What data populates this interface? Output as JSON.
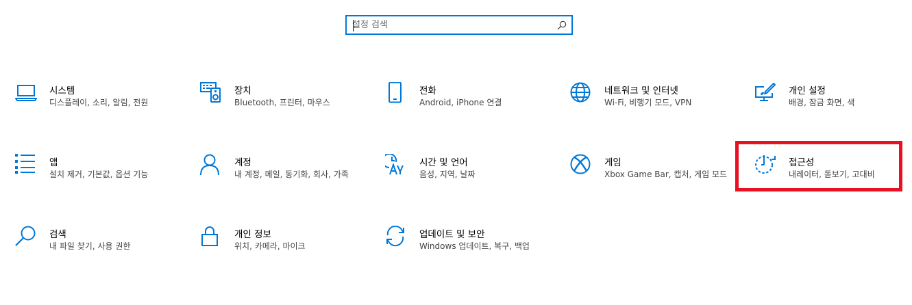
{
  "search": {
    "placeholder": "설정 검색",
    "value": ""
  },
  "accent_color": "#0078d7",
  "highlight_color": "#e81123",
  "tiles": [
    {
      "icon": "laptop-icon",
      "title": "시스템",
      "desc": "디스플레이, 소리, 알림, 전원"
    },
    {
      "icon": "keyboard-devices-icon",
      "title": "장치",
      "desc": "Bluetooth, 프린터, 마우스"
    },
    {
      "icon": "phone-icon",
      "title": "전화",
      "desc": "Android, iPhone 연결"
    },
    {
      "icon": "globe-icon",
      "title": "네트워크 및 인터넷",
      "desc": "Wi-Fi, 비행기 모드, VPN"
    },
    {
      "icon": "paint-monitor-icon",
      "title": "개인 설정",
      "desc": "배경, 잠금 화면, 색"
    },
    {
      "icon": "apps-list-icon",
      "title": "앱",
      "desc": "설치 제거, 기본값, 옵션 기능"
    },
    {
      "icon": "person-icon",
      "title": "계정",
      "desc": "내 계정, 메일, 동기화, 회사, 가족"
    },
    {
      "icon": "time-language-icon",
      "title": "시간 및 언어",
      "desc": "음성, 지역, 날짜"
    },
    {
      "icon": "xbox-icon",
      "title": "게임",
      "desc": "Xbox Game Bar, 캡처, 게임 모드"
    },
    {
      "icon": "accessibility-timer-icon",
      "title": "접근성",
      "desc": "내레이터, 돋보기, 고대비"
    },
    {
      "icon": "search-icon",
      "title": "검색",
      "desc": "내 파일 찾기, 사용 권한"
    },
    {
      "icon": "lock-icon",
      "title": "개인 정보",
      "desc": "위치, 카메라, 마이크"
    },
    {
      "icon": "sync-icon",
      "title": "업데이트 및 보안",
      "desc": "Windows 업데이트, 복구, 백업"
    }
  ]
}
